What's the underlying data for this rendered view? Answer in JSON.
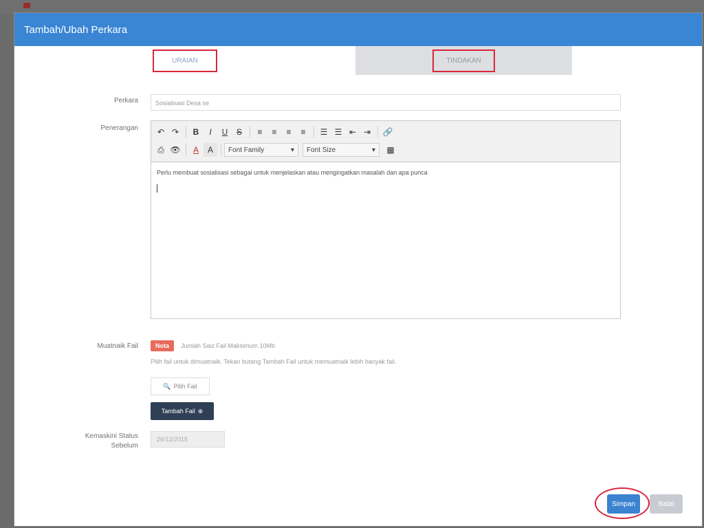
{
  "modal": {
    "title": "Tambah/Ubah Perkara"
  },
  "tabs": [
    {
      "label": "URAIAN"
    },
    {
      "label": "TINDAKAN"
    }
  ],
  "form": {
    "perkara_label": "Perkara",
    "perkara_value": "Sosialisasi Desa se",
    "penerangan_label": "Penerangan",
    "editor_text": "Perlu membuat sosialisasi sebagai untuk menjelaskan atau mengingatkan masalah dan apa punca",
    "toolbar": {
      "font_family": "Font Family",
      "font_size": "Font Size",
      "undo": "↶",
      "redo": "↷",
      "bold": "B",
      "italic": "I",
      "underline": "U",
      "strike": "S",
      "align_left": "≡",
      "align_center": "≡",
      "align_right": "≡",
      "align_justify": "≡",
      "bullet_list": "☰",
      "number_list": "☰",
      "outdent": "⇤",
      "indent": "⇥",
      "link": "🔗",
      "print": "⎙",
      "preview": "👁",
      "text_color": "A",
      "bg_color": "A",
      "table": "▦"
    },
    "upload_label": "Muatnaik Fail",
    "upload_badge": "Nota",
    "upload_note": "Jumlah Saiz Fail Maksimum 10Mb",
    "upload_help": "Pilih fail untuk dimuatnaik. Tekan butang Tambah Fail untuk memuatnaik lebih banyak fail.",
    "pilih_fail": "Pilih Fail",
    "tambah_fail": "Tambah Fail",
    "tarikh_label_1": "Kemaskini Status",
    "tarikh_label_2": "Sebelum",
    "tarikh_value": "26/12/2015"
  },
  "footer": {
    "simpan": "Simpan",
    "batal": "Batal"
  },
  "colors": {
    "header": "#3a85d4",
    "highlight": "#d9263a",
    "tambah_btn": "#2f3f55",
    "badge": "#e86a5b"
  }
}
